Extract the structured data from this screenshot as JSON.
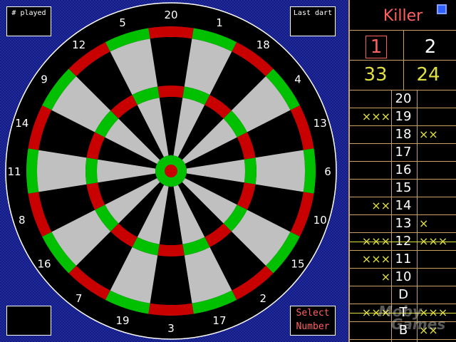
{
  "board": {
    "numbers": [
      "20",
      "1",
      "18",
      "4",
      "13",
      "6",
      "10",
      "15",
      "2",
      "17",
      "3",
      "19",
      "7",
      "16",
      "8",
      "11",
      "14",
      "9",
      "12",
      "5"
    ],
    "played_label": "# played",
    "last_dart_label": "Last dart",
    "select_button": [
      "Select",
      "Number"
    ],
    "colors": {
      "red": "#c80000",
      "green": "#00c000",
      "light": "#c0c0c0",
      "dark": "#000000",
      "background": "#101a8a"
    }
  },
  "panel": {
    "title": "Killer",
    "players": [
      "1",
      "2"
    ],
    "scores": [
      "33",
      "24"
    ],
    "rows": [
      {
        "label": "20",
        "left": "",
        "right": "",
        "struck": false
      },
      {
        "label": "19",
        "left": "×××",
        "right": "",
        "struck": false
      },
      {
        "label": "18",
        "left": "",
        "right": "××",
        "struck": false
      },
      {
        "label": "17",
        "left": "",
        "right": "",
        "struck": false
      },
      {
        "label": "16",
        "left": "",
        "right": "",
        "struck": false
      },
      {
        "label": "15",
        "left": "",
        "right": "",
        "struck": false
      },
      {
        "label": "14",
        "left": "××",
        "right": "",
        "struck": false
      },
      {
        "label": "13",
        "left": "",
        "right": "×",
        "struck": false
      },
      {
        "label": "12",
        "left": "×××",
        "right": "×××",
        "struck": true
      },
      {
        "label": "11",
        "left": "×××",
        "right": "",
        "struck": false
      },
      {
        "label": "10",
        "left": "×",
        "right": "",
        "struck": false
      },
      {
        "label": "D",
        "left": "",
        "right": "",
        "struck": false
      },
      {
        "label": "T",
        "left": "×××",
        "right": "×××",
        "struck": true
      },
      {
        "label": "B",
        "left": "",
        "right": "××",
        "struck": false
      }
    ]
  },
  "watermark": [
    "Moby",
    "Games"
  ]
}
